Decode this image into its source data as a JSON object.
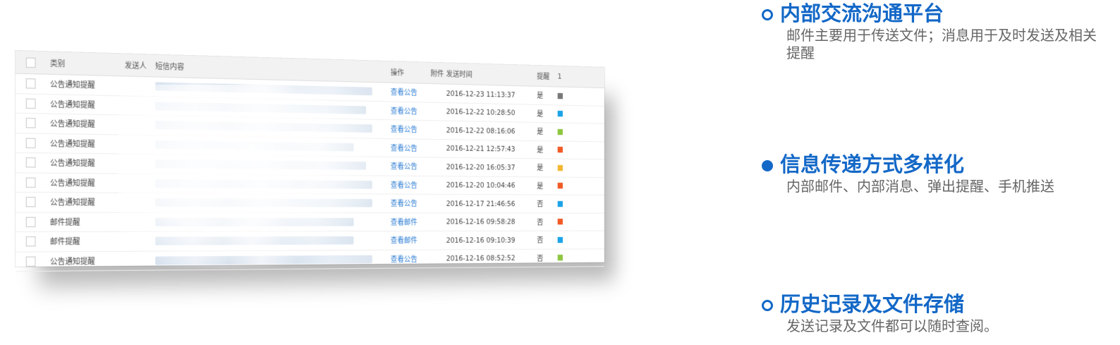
{
  "table": {
    "headers": {
      "type": "类别",
      "sender": "发送人",
      "content": "短信内容",
      "action": "操作",
      "attachment": "附件",
      "time": "发送时间",
      "remind": "提醒",
      "flag": "1"
    },
    "rows": [
      {
        "type": "公告通知提醒",
        "action": "查看公告",
        "time": "2016-12-23 11:13:37",
        "remind": "是",
        "flag_color": "#777777"
      },
      {
        "type": "公告通知提醒",
        "action": "查看公告",
        "time": "2016-12-22 10:28:50",
        "remind": "是",
        "flag_color": "#1ba3e8"
      },
      {
        "type": "公告通知提醒",
        "action": "查看公告",
        "time": "2016-12-22 08:16:06",
        "remind": "是",
        "flag_color": "#8dc63f"
      },
      {
        "type": "公告通知提醒",
        "action": "查看公告",
        "time": "2016-12-21 12:57:43",
        "remind": "是",
        "flag_color": "#f15a24"
      },
      {
        "type": "公告通知提醒",
        "action": "查看公告",
        "time": "2016-12-20 16:05:37",
        "remind": "是",
        "flag_color": "#f7b731"
      },
      {
        "type": "公告通知提醒",
        "action": "查看公告",
        "time": "2016-12-20 10:04:46",
        "remind": "是",
        "flag_color": "#f15a24"
      },
      {
        "type": "公告通知提醒",
        "action": "查看公告",
        "time": "2016-12-17 21:46:56",
        "remind": "否",
        "flag_color": "#1ba3e8"
      },
      {
        "type": "邮件提醒",
        "action": "查看邮件",
        "time": "2016-12-16 09:58:28",
        "remind": "否",
        "flag_color": "#f15a24"
      },
      {
        "type": "邮件提醒",
        "action": "查看邮件",
        "time": "2016-12-16 09:10:39",
        "remind": "否",
        "flag_color": "#1ba3e8"
      },
      {
        "type": "公告通知提醒",
        "action": "查看公告",
        "time": "2016-12-16 08:52:52",
        "remind": "否",
        "flag_color": "#8dc63f"
      }
    ]
  },
  "features": [
    {
      "title": "内部交流沟通平台",
      "desc": "邮件主要用于传送文件；消息用于及时发送及相关提醒",
      "bullet": "open-circle"
    },
    {
      "title": "信息传递方式多样化",
      "desc": "内部邮件、内部消息、弹出提醒、手机推送",
      "bullet": "filled-circle"
    },
    {
      "title": "历史记录及文件存储",
      "desc": "发送记录及文件都可以随时查阅。",
      "bullet": "open-circle"
    }
  ],
  "colors": {
    "accent": "#1368c7",
    "link": "#2b7cd3"
  }
}
